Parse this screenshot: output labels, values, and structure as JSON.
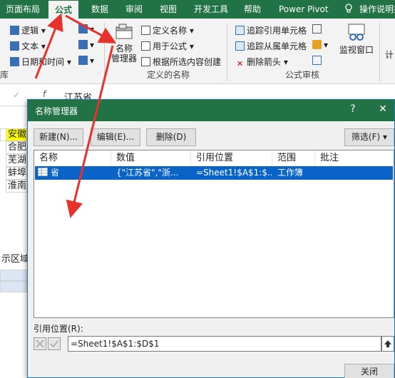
{
  "ribbon_tabs": [
    "页面布局",
    "公式",
    "数据",
    "审阅",
    "视图",
    "开发工具",
    "帮助",
    "Power Pivot",
    "操作说明搜"
  ],
  "ribbon": {
    "function_lib": {
      "items": [
        "逻辑",
        "文本",
        "日期和时间"
      ],
      "group_label": "库"
    },
    "defined_names": {
      "name_manager": "名称\n管理器",
      "name_manager_line1": "名称",
      "name_manager_line2": "管理器",
      "define_name": "定义名称",
      "use_in_formula": "用于公式",
      "create_from_selection": "根据所选内容创建",
      "group_label": "定义的名称"
    },
    "formula_auditing": {
      "trace_precedents": "追踪引用单元格",
      "trace_dependents": "追踪从属单元格",
      "remove_arrows": "删除箭头",
      "group_label": "公式审核",
      "watch_window": "监视窗口",
      "calc_partial": "计"
    }
  },
  "formula_bar": {
    "content": "江苏省"
  },
  "sheet": {
    "cells": [
      "安徽",
      "合肥",
      "芜湖",
      "蚌埠",
      "淮南"
    ],
    "fragment": "示区域"
  },
  "dialog": {
    "title": "名称管理器",
    "help": "?",
    "close": "✕",
    "buttons": {
      "new": "新建(N)...",
      "edit": "编辑(E)...",
      "delete": "删除(D)",
      "filter": "筛选(F)"
    },
    "columns": [
      "名称",
      "数值",
      "引用位置",
      "范围",
      "批注"
    ],
    "rows": [
      {
        "name": "省",
        "value": "{\"江苏省\",\"浙...",
        "refers_to": "=Sheet1!$A$1:$...",
        "scope": "工作簿",
        "comment": ""
      }
    ],
    "ref_label": "引用位置(R):",
    "ref_value": "=Sheet1!$A$1:$D$1",
    "close_button": "关闭"
  },
  "colors": {
    "accent": "#217346",
    "selection": "#0a64c8",
    "arrow": "#e8312a"
  }
}
